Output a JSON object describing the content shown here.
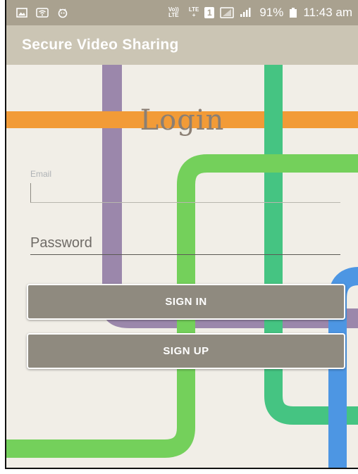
{
  "status_bar": {
    "icons": [
      "image-icon",
      "wifi-icon",
      "notification-icon"
    ],
    "volte_top": "Vo))",
    "volte_bottom": "LTE",
    "lte_top": "LTE",
    "lte_bottom": "+",
    "sim_number": "1",
    "battery_percent": "91%",
    "time": "11:43 am"
  },
  "app_bar": {
    "title": "Secure Video Sharing"
  },
  "login": {
    "title": "Login",
    "email_label": "Email",
    "email_value": "",
    "password_placeholder": "Password",
    "password_value": "",
    "signin_label": "SIGN IN",
    "signup_label": "SIGN UP"
  },
  "colors": {
    "status_bar": "#a9a18f",
    "app_bar": "#cbc5b4",
    "background": "#f1eee7",
    "button": "#8f8a7f",
    "line_purple": "#9b87ab",
    "line_orange": "#f29b37",
    "line_teal": "#45c482",
    "line_green": "#74d05b",
    "line_blue": "#4d96e3",
    "title_text": "#8b7f74"
  }
}
